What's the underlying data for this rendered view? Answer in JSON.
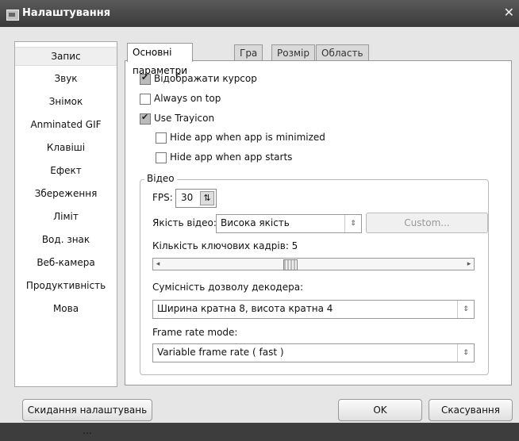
{
  "window": {
    "title": "Налаштування",
    "close_glyph": "✕"
  },
  "sidebar": {
    "items": [
      {
        "label": "Запис",
        "selected": true
      },
      {
        "label": "Звук"
      },
      {
        "label": "Знімок"
      },
      {
        "label": "Anminated GIF"
      },
      {
        "label": "Клавіші"
      },
      {
        "label": "Ефект"
      },
      {
        "label": "Збереження"
      },
      {
        "label": "Ліміт"
      },
      {
        "label": "Вод. знак"
      },
      {
        "label": "Веб-камера"
      },
      {
        "label": "Продуктивність"
      },
      {
        "label": "Мова"
      }
    ]
  },
  "tabs": [
    {
      "label": "Основні параметри",
      "active": true
    },
    {
      "label": "Гра"
    },
    {
      "label": "Розмір"
    },
    {
      "label": "Область запису"
    }
  ],
  "options": {
    "show_cursor": {
      "label": "Відображати курсор",
      "checked": true
    },
    "always_on_top": {
      "label": "Always on top",
      "checked": false
    },
    "use_trayicon": {
      "label": "Use Trayicon",
      "checked": true
    },
    "hide_minimized": {
      "label": "Hide app when app is minimized",
      "checked": false
    },
    "hide_starts": {
      "label": "Hide app when app starts",
      "checked": false
    }
  },
  "video": {
    "group_title": "Відео",
    "fps_label": "FPS:",
    "fps_value": "30",
    "quality_label": "Якість відео:",
    "quality_value": "Висока якість",
    "custom_button": "Custom...",
    "keyframes_label": "Кількість ключових кадрів: 5",
    "keyframes_slider_fraction": 0.42,
    "decoder_label": "Сумісність дозволу декодера:",
    "decoder_value": "Ширина кратна 8, висота кратна 4",
    "framerate_label": "Frame rate mode:",
    "framerate_value": "Variable frame rate ( fast )"
  },
  "footer": {
    "reset_button": "Скидання налаштувань ...",
    "ok_button": "OK",
    "cancel_button": "Скасування"
  }
}
